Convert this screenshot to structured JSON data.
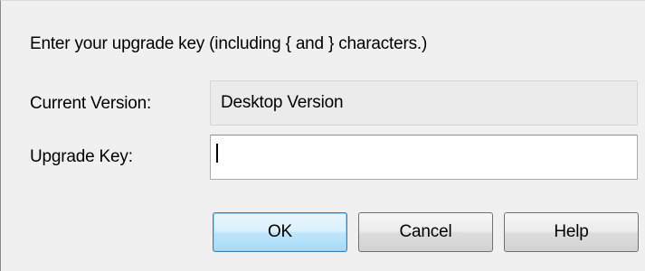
{
  "dialog": {
    "instructions": "Enter your upgrade key (including { and } characters.)",
    "current_version_label": "Current Version:",
    "current_version_value": "Desktop Version",
    "upgrade_key_label": "Upgrade Key:",
    "upgrade_key_value": "",
    "upgrade_key_placeholder": ""
  },
  "buttons": {
    "ok": "OK",
    "cancel": "Cancel",
    "help": "Help"
  },
  "colors": {
    "dialog_background": "#f0f0f0",
    "default_button_accent": "#3c7fb1",
    "readonly_field_background": "#ebebeb"
  }
}
